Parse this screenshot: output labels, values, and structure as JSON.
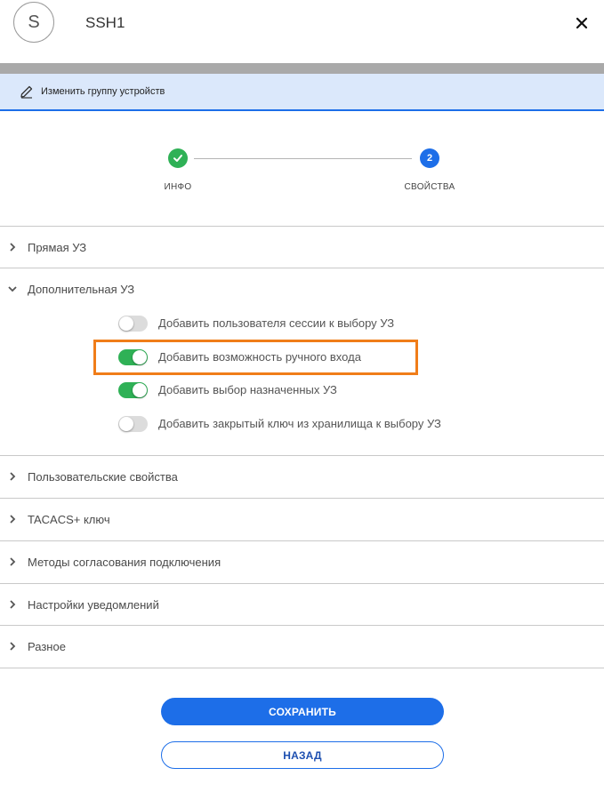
{
  "header": {
    "avatar_letter": "S",
    "title": "SSH1"
  },
  "banner": {
    "label": "Изменить группу устройств"
  },
  "stepper": {
    "steps": [
      {
        "label": "ИНФО",
        "state": "complete"
      },
      {
        "label": "СВОЙСТВА",
        "number": "2",
        "state": "active"
      }
    ]
  },
  "sections": [
    {
      "label": "Прямая УЗ",
      "expanded": false
    },
    {
      "label": "Дополнительная УЗ",
      "expanded": true
    },
    {
      "label": "Пользовательские свойства",
      "expanded": false
    },
    {
      "label": "TACACS+ ключ",
      "expanded": false
    },
    {
      "label": "Методы согласования подключения",
      "expanded": false
    },
    {
      "label": "Настройки уведомлений",
      "expanded": false
    },
    {
      "label": "Разное",
      "expanded": false
    }
  ],
  "toggles": [
    {
      "label": "Добавить пользователя сессии к выбору УЗ",
      "on": false
    },
    {
      "label": "Добавить возможность ручного входа",
      "on": true
    },
    {
      "label": "Добавить выбор назначенных УЗ",
      "on": true
    },
    {
      "label": "Добавить закрытый ключ из хранилища к выбору УЗ",
      "on": false
    }
  ],
  "buttons": {
    "save": "СОХРАНИТЬ",
    "back": "НАЗАД"
  },
  "colors": {
    "primary": "#1d6ee8",
    "success": "#2fb156",
    "highlight": "#f07d19",
    "banner_bg": "#dbe8fb"
  }
}
